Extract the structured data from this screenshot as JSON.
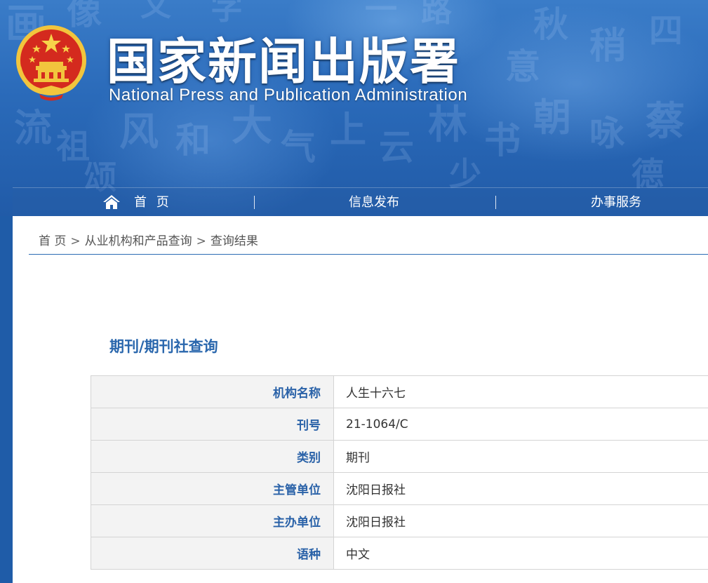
{
  "header": {
    "title_cn": "国家新闻出版署",
    "title_en": "National  Press and Publication Administration"
  },
  "nav": {
    "home": "首 页",
    "info": "信息发布",
    "service": "办事服务"
  },
  "breadcrumb": [
    "首 页",
    "从业机构和产品查询",
    "查询结果"
  ],
  "section_title": "期刊/期刊社查询",
  "details": [
    {
      "label": "机构名称",
      "value": "人生十六七"
    },
    {
      "label": "刊号",
      "value": "21-1064/C"
    },
    {
      "label": "类别",
      "value": "期刊"
    },
    {
      "label": "主管单位",
      "value": "沈阳日报社"
    },
    {
      "label": "主办单位",
      "value": "沈阳日报社"
    },
    {
      "label": "语种",
      "value": "中文"
    }
  ],
  "colors": {
    "banner": "#2a6ab9",
    "accent": "#2a67ad",
    "emblem_red": "#d42a1e",
    "emblem_gold": "#f2c53d"
  },
  "icons": [
    "national-emblem-icon",
    "home-icon"
  ]
}
